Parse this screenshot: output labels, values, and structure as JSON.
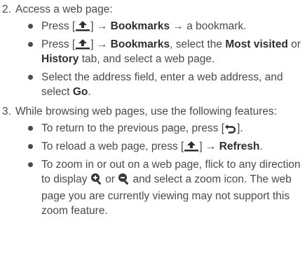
{
  "steps": [
    {
      "number": "2.",
      "intro": "Access a web page:",
      "bullets": [
        {
          "parts": [
            "Press [",
            "] → ",
            "Bookmarks",
            " → a bookmark."
          ]
        },
        {
          "parts": [
            "Press [",
            "] → ",
            "Bookmarks",
            ", select the ",
            "Most visited",
            " or ",
            "History",
            " tab, and select a web page."
          ]
        },
        {
          "parts": [
            "Select the address field, enter a web address, and select ",
            "Go",
            "."
          ]
        }
      ]
    },
    {
      "number": "3.",
      "intro": "While browsing web pages, use the following features:",
      "bullets": [
        {
          "parts": [
            "To return to the previous page, press [",
            "]."
          ]
        },
        {
          "parts": [
            "To reload a web page, press [",
            "] → ",
            "Refresh",
            "."
          ]
        },
        {
          "parts": [
            "To zoom in or out on a web page, flick to any direction to display ",
            " or ",
            " and select a zoom icon. The web page you are currently viewing may not support this zoom feature."
          ]
        }
      ]
    }
  ],
  "icons": {
    "menu_key": "menu-key-icon",
    "back_key": "back-key-icon",
    "zoom_in": "zoom-in-icon",
    "zoom_out": "zoom-out-icon"
  }
}
